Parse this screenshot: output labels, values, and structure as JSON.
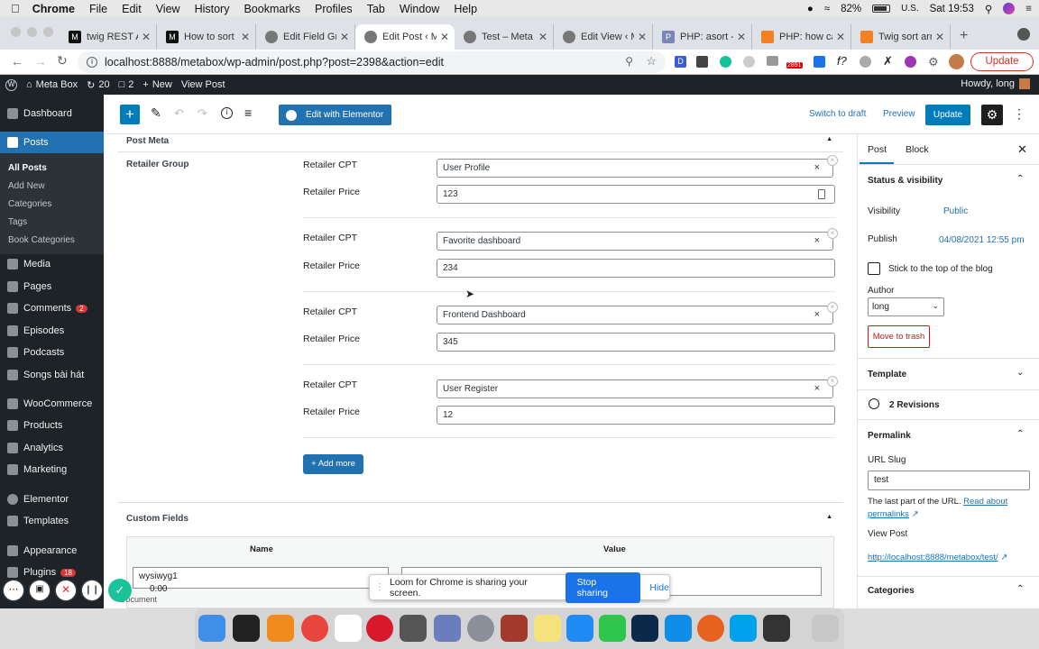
{
  "mac_menubar": {
    "app": "Chrome",
    "menus": [
      "File",
      "Edit",
      "View",
      "History",
      "Bookmarks",
      "Profiles",
      "Tab",
      "Window",
      "Help"
    ],
    "battery": "82%",
    "input_source": "U.S.",
    "clock": "Sat 19:53"
  },
  "tabs": [
    {
      "label": "twig REST AP"
    },
    {
      "label": "How to sort"
    },
    {
      "label": "Edit Field Gr"
    },
    {
      "label": "Edit Post ‹ M"
    },
    {
      "label": "Test – Meta B"
    },
    {
      "label": "Edit View ‹ M"
    },
    {
      "label": "PHP: asort -"
    },
    {
      "label": "PHP: how ca"
    },
    {
      "label": "Twig sort arr"
    }
  ],
  "address": {
    "url": "localhost:8888/metabox/wp-admin/post.php?post=2398&action=edit",
    "update_label": "Update",
    "badge_count": "2891"
  },
  "wp_adminbar": {
    "site": "Meta Box",
    "updates": "20",
    "comments": "2",
    "new": "New",
    "view_post": "View Post",
    "howdy": "Howdy, long"
  },
  "sidebar": {
    "items": [
      {
        "label": "Dashboard"
      },
      {
        "label": "Posts"
      },
      {
        "label": "Media"
      },
      {
        "label": "Pages"
      },
      {
        "label": "Comments",
        "badge": "2"
      },
      {
        "label": "Episodes"
      },
      {
        "label": "Podcasts"
      },
      {
        "label": "Songs bài hát"
      },
      {
        "label": "WooCommerce"
      },
      {
        "label": "Products"
      },
      {
        "label": "Analytics"
      },
      {
        "label": "Marketing"
      },
      {
        "label": "Elementor"
      },
      {
        "label": "Templates"
      },
      {
        "label": "Appearance"
      },
      {
        "label": "Plugins",
        "badge": "18"
      }
    ],
    "posts_sub": [
      "All Posts",
      "Add New",
      "Categories",
      "Tags",
      "Book Categories"
    ]
  },
  "toolbar": {
    "elementor": "Edit with Elementor",
    "switch_draft": "Switch to draft",
    "preview": "Preview",
    "update": "Update"
  },
  "metabox": {
    "title": "Post Meta",
    "group_label": "Retailer Group",
    "cpt_label": "Retailer CPT",
    "price_label": "Retailer Price",
    "rows": [
      {
        "cpt": "User Profile",
        "price": "123"
      },
      {
        "cpt": "Favorite dashboard",
        "price": "234"
      },
      {
        "cpt": "Frontend Dashboard",
        "price": "345"
      },
      {
        "cpt": "User Register",
        "price": "12"
      }
    ],
    "add_more": "+ Add more"
  },
  "custom_fields": {
    "title": "Custom Fields",
    "col_name": "Name",
    "col_value": "Value",
    "name_value": "wysiwyg1",
    "row_hint": "Document"
  },
  "settings_panel": {
    "tabs": [
      "Post",
      "Block"
    ],
    "status_title": "Status & visibility",
    "visibility_label": "Visibility",
    "visibility_value": "Public",
    "publish_label": "Publish",
    "publish_value": "04/08/2021 12:55 pm",
    "sticky_label": "Stick to the top of the blog",
    "author_label": "Author",
    "author_value": "long",
    "trash": "Move to trash",
    "template": "Template",
    "revisions": "2 Revisions",
    "permalink": "Permalink",
    "url_slug_label": "URL Slug",
    "url_slug_value": "test",
    "help_text": "The last part of the URL.",
    "read_about": "Read about",
    "permalinks": "permalinks",
    "view_post": "View Post",
    "post_link": "http://localhost:8888/metabox/test/",
    "categories": "Categories"
  },
  "loom": {
    "message": "Loom for Chrome is sharing your screen.",
    "stop": "Stop sharing",
    "hide": "Hide",
    "timer": "0:00"
  },
  "colors": {
    "wp_dark": "#1d2327",
    "wp_blue": "#2271b1",
    "gutenberg_blue": "#007cba",
    "loom_blue": "#1a73e8"
  }
}
